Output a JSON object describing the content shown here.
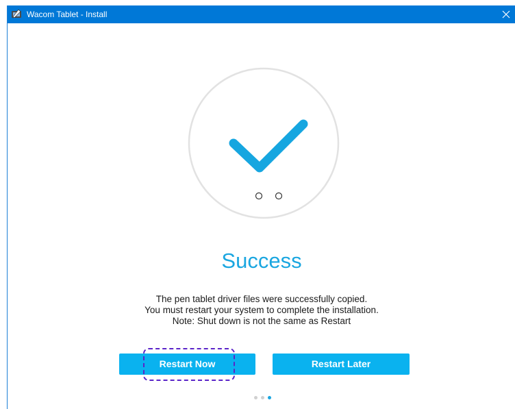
{
  "window": {
    "title": "Wacom Tablet - Install",
    "app_icon": "wacom-tablet-icon",
    "close_icon": "close-icon",
    "titlebar_color": "#0078d7"
  },
  "illustration": {
    "icon": "checkmark-icon",
    "check_color": "#16a6e0",
    "circle_color": "#e2e2e2",
    "indicator_count": 2
  },
  "heading": "Success",
  "heading_color": "#1aa6e0",
  "message": {
    "line1": "The pen tablet driver files were successfully copied.",
    "line2": "You must restart your system to complete the installation.",
    "line3": "Note: Shut down is not the same as Restart"
  },
  "buttons": {
    "restart_now": "Restart Now",
    "restart_later": "Restart Later",
    "color": "#0ab2ef"
  },
  "pager": {
    "total": 3,
    "current": 3,
    "active_color": "#1aa6e0",
    "inactive_color": "#d0d0d0"
  }
}
